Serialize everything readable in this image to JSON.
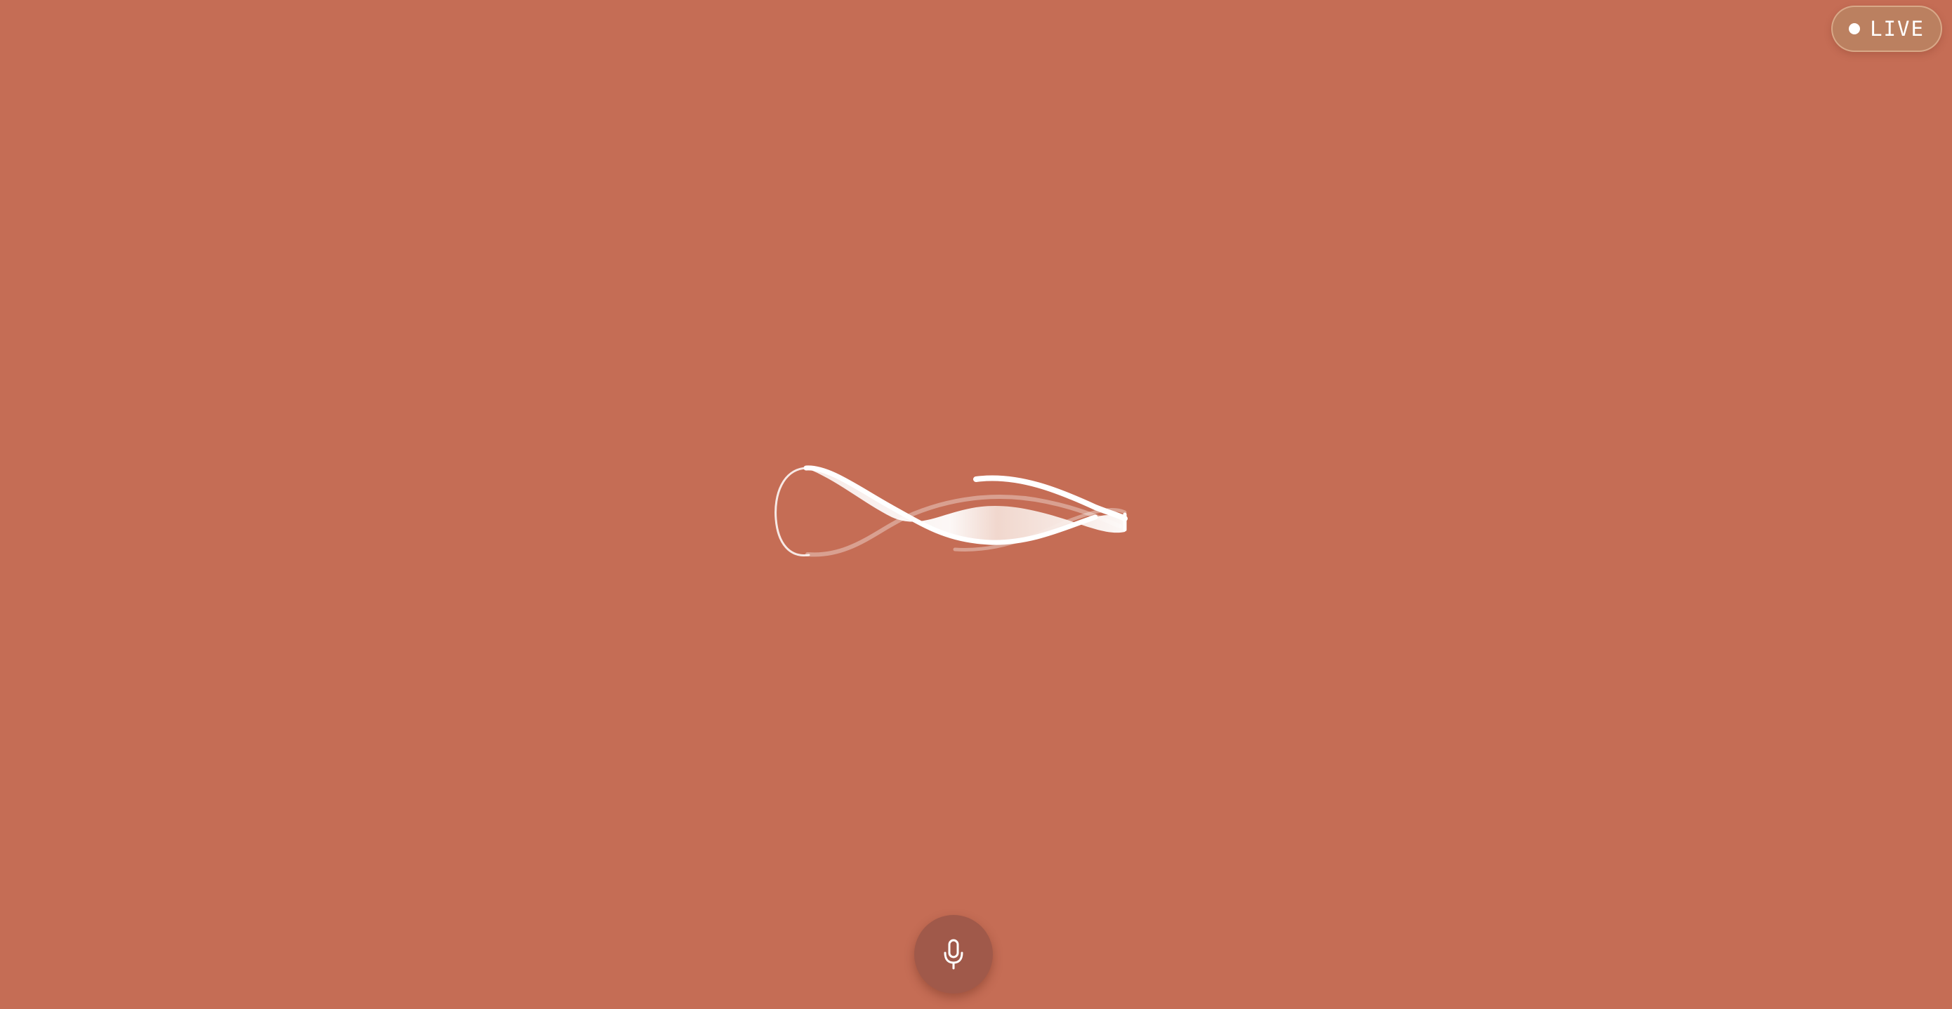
{
  "status_badge": {
    "label": "LIVE",
    "dot_color": "#ffffff"
  },
  "visualizer": {
    "icon": "infinity-ribbon-icon"
  },
  "mic_button": {
    "icon": "microphone-icon"
  },
  "colors": {
    "background": "#c56d55",
    "mic_button": "#a0594a",
    "badge": "#bb8060",
    "ribbon": "#ffffff"
  }
}
